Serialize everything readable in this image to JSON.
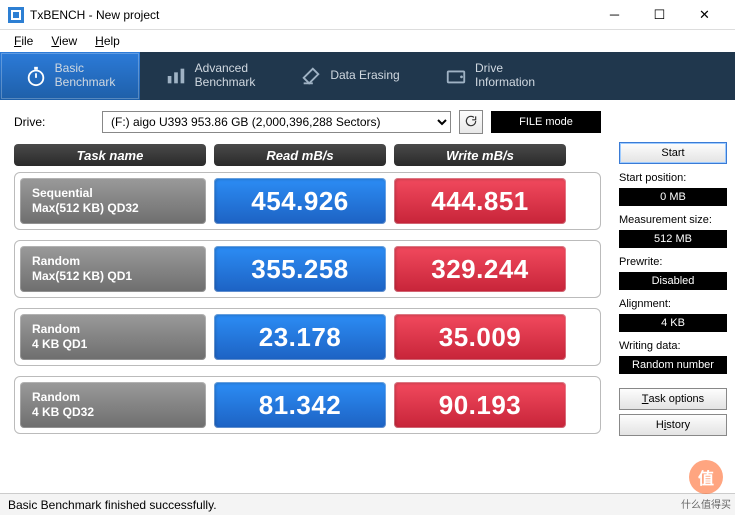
{
  "window": {
    "title": "TxBENCH - New project"
  },
  "menu": {
    "file": "File",
    "view": "View",
    "help": "Help"
  },
  "tabs": {
    "basic": "Basic\nBenchmark",
    "advanced": "Advanced\nBenchmark",
    "erasing": "Data Erasing",
    "driveinfo": "Drive\nInformation"
  },
  "drive": {
    "label": "Drive:",
    "selected": "(F:) aigo U393  953.86 GB (2,000,396,288 Sectors)"
  },
  "filemode": "FILE mode",
  "headers": {
    "task": "Task name",
    "read": "Read mB/s",
    "write": "Write mB/s"
  },
  "rows": [
    {
      "name1": "Sequential",
      "name2": "Max(512 KB) QD32",
      "read": "454.926",
      "write": "444.851"
    },
    {
      "name1": "Random",
      "name2": "Max(512 KB) QD1",
      "read": "355.258",
      "write": "329.244"
    },
    {
      "name1": "Random",
      "name2": "4 KB QD1",
      "read": "23.178",
      "write": "35.009"
    },
    {
      "name1": "Random",
      "name2": "4 KB QD32",
      "read": "81.342",
      "write": "90.193"
    }
  ],
  "side": {
    "start": "Start",
    "startpos_label": "Start position:",
    "startpos_val": "0 MB",
    "meassize_label": "Measurement size:",
    "meassize_val": "512 MB",
    "prewrite_label": "Prewrite:",
    "prewrite_val": "Disabled",
    "align_label": "Alignment:",
    "align_val": "4 KB",
    "wdata_label": "Writing data:",
    "wdata_val": "Random number",
    "taskopts": "Task options",
    "history": "History"
  },
  "status": "Basic Benchmark finished successfully.",
  "watermark": "什么值得买",
  "chart_data": {
    "type": "table",
    "title": "TxBENCH Basic Benchmark",
    "columns": [
      "Task name",
      "Read mB/s",
      "Write mB/s"
    ],
    "rows": [
      [
        "Sequential Max(512 KB) QD32",
        454.926,
        444.851
      ],
      [
        "Random Max(512 KB) QD1",
        355.258,
        329.244
      ],
      [
        "Random 4 KB QD1",
        23.178,
        35.009
      ],
      [
        "Random 4 KB QD32",
        81.342,
        90.193
      ]
    ]
  }
}
